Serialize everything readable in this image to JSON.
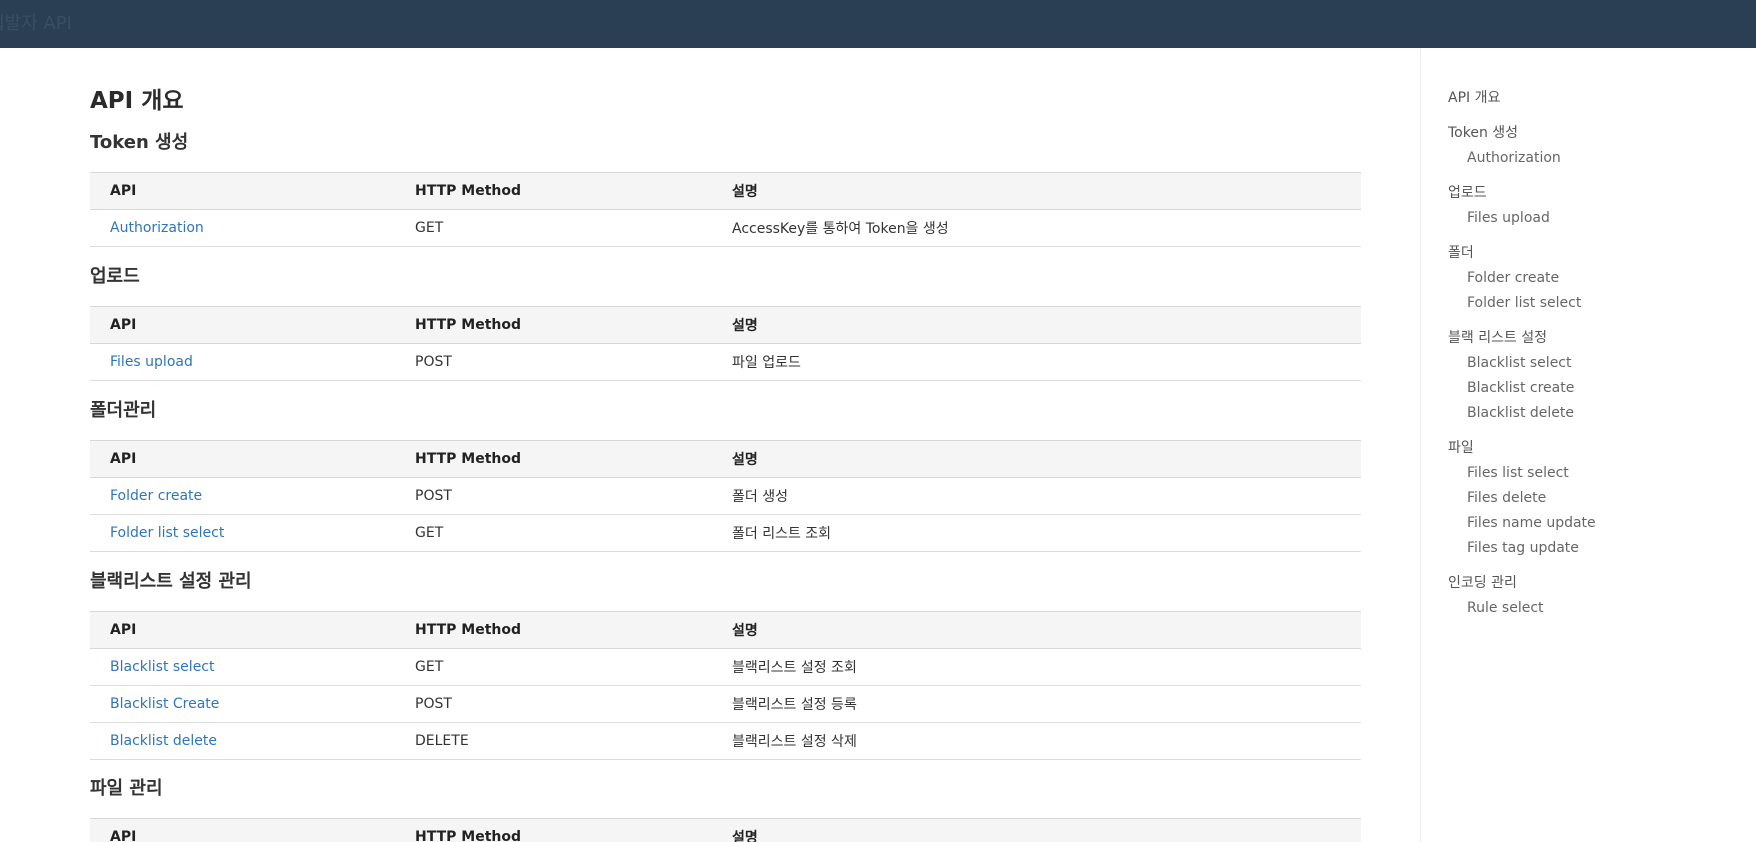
{
  "header": {
    "brand": "웹발자 API"
  },
  "page": {
    "title": "API 개요"
  },
  "table_headers": {
    "api": "API",
    "method": "HTTP Method",
    "desc": "설명"
  },
  "sections": [
    {
      "title": "Token 생성",
      "rows": [
        {
          "api": "Authorization",
          "method": "GET",
          "desc": "AccessKey를 통하여 Token을 생성"
        }
      ]
    },
    {
      "title": "업로드",
      "rows": [
        {
          "api": "Files upload",
          "method": "POST",
          "desc": "파일 업로드"
        }
      ]
    },
    {
      "title": "폴더관리",
      "rows": [
        {
          "api": "Folder create",
          "method": "POST",
          "desc": "폴더 생성"
        },
        {
          "api": "Folder list select",
          "method": "GET",
          "desc": "폴더 리스트 조회"
        }
      ]
    },
    {
      "title": "블랙리스트 설정 관리",
      "rows": [
        {
          "api": "Blacklist select",
          "method": "GET",
          "desc": "블랙리스트 설정 조회"
        },
        {
          "api": "Blacklist Create",
          "method": "POST",
          "desc": "블랙리스트 설정 등록"
        },
        {
          "api": "Blacklist delete",
          "method": "DELETE",
          "desc": "블랙리스트 설정 삭제"
        }
      ]
    },
    {
      "title": "파일 관리",
      "rows": []
    }
  ],
  "sidebar": {
    "groups": [
      {
        "label": "API 개요",
        "items": []
      },
      {
        "label": "Token 생성",
        "items": [
          "Authorization"
        ]
      },
      {
        "label": "업로드",
        "items": [
          "Files upload"
        ]
      },
      {
        "label": "폴더",
        "items": [
          "Folder create",
          "Folder list select"
        ]
      },
      {
        "label": "블랙 리스트 설정",
        "items": [
          "Blacklist select",
          "Blacklist create",
          "Blacklist delete"
        ]
      },
      {
        "label": "파일",
        "items": [
          "Files list select",
          "Files delete",
          "Files name update",
          "Files tag update"
        ]
      },
      {
        "label": "인코딩 관리",
        "items": [
          "Rule select"
        ]
      }
    ]
  },
  "colors": {
    "topbar": "#2a3f54",
    "link": "#2e76b8",
    "table_header_bg": "#f5f5f5"
  }
}
